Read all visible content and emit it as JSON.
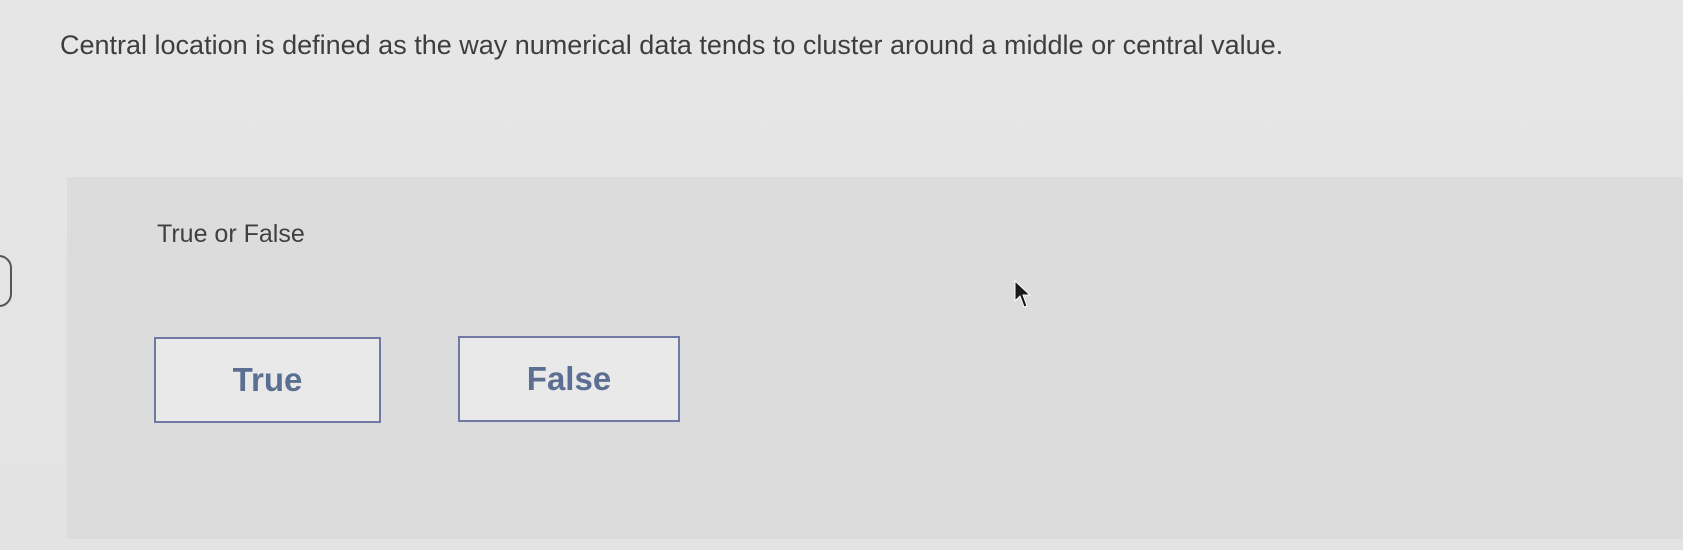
{
  "question": {
    "text": "Central location is defined as the way numerical data tends to cluster around a middle or central value."
  },
  "answer_panel": {
    "prompt": "True or False",
    "options": [
      {
        "label": "True"
      },
      {
        "label": "False"
      }
    ]
  },
  "colors": {
    "page_background": "#e5e5e5",
    "panel_background": "#dcdcdc",
    "button_border": "#6f79a3",
    "button_text": "#5b6f93",
    "body_text": "#3e3e3e"
  },
  "icons": {
    "cursor": "mouse-pointer-icon",
    "edge_tab": "side-tab-handle"
  }
}
